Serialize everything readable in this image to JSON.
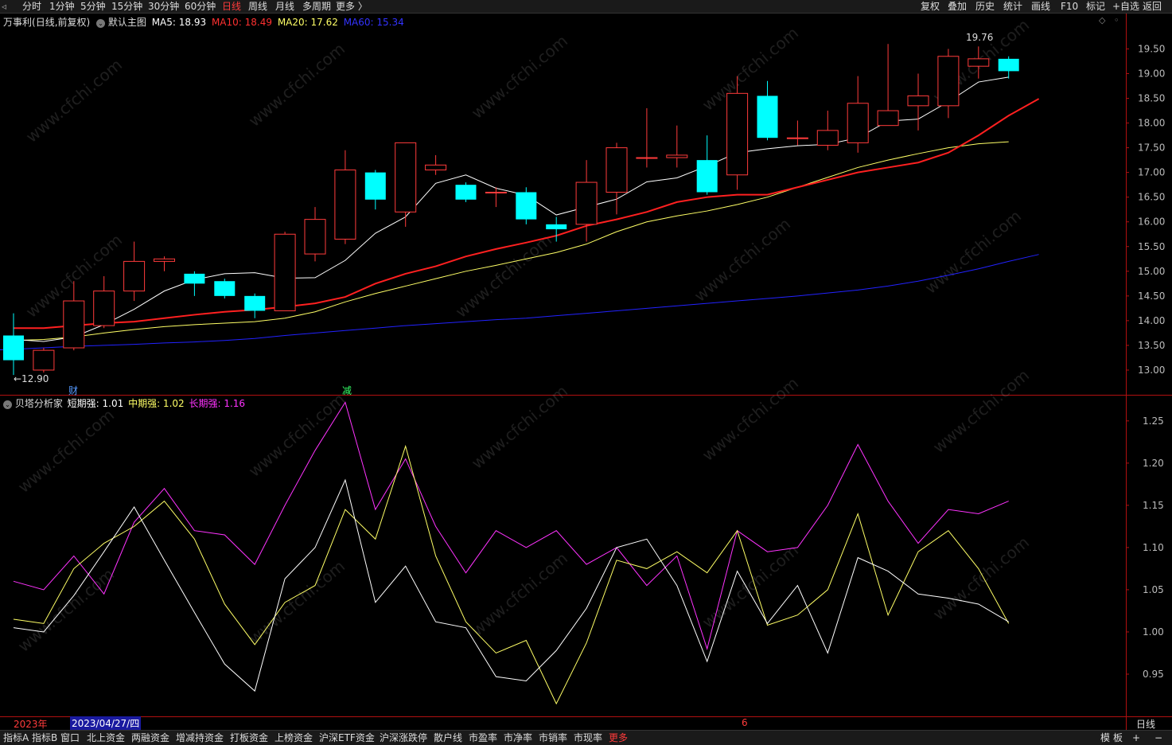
{
  "topbar": {
    "periods": [
      "分时",
      "1分钟",
      "5分钟",
      "15分钟",
      "30分钟",
      "60分钟",
      "日线",
      "周线",
      "月线",
      "多周期",
      "更多 〉"
    ],
    "active": "日线",
    "right_tools": [
      "复权",
      "叠加",
      "历史",
      "统计",
      "画线",
      "F10",
      "标记",
      "+自选",
      "返回"
    ]
  },
  "main_info": {
    "stock": "万事利",
    "period_label": "(日线,前复权)",
    "chart_name": "默认主图",
    "ma5_label": "MA5: 18.93",
    "ma10_label": "MA10: 18.49",
    "ma20_label": "MA20: 17.62",
    "ma60_label": "MA60: 15.34"
  },
  "annotations": {
    "high_label": "19.76",
    "low_label": "←12.90",
    "event_cai": "财",
    "event_jian": "减"
  },
  "indicator_info": {
    "name": "贝塔分析家",
    "short_label": "短期强: 1.01",
    "mid_label": "中期强: 1.02",
    "long_label": "长期强: 1.16"
  },
  "date_axis": {
    "year_label": "2023年",
    "cursor_date": "2023/04/27/四",
    "month_marker": "6",
    "period_right": "日线"
  },
  "bottombar": {
    "tabs": [
      "指标A",
      "指标B",
      "窗口",
      "北上资金",
      "两融资金",
      "增减持资金",
      "打板资金",
      "上榜资金",
      "沪深ETF资金",
      "沪深涨跌停",
      "散户线",
      "市盈率",
      "市净率",
      "市销率",
      "市现率",
      "更多"
    ],
    "right": [
      "模",
      "板",
      "+",
      "−"
    ]
  },
  "colors": {
    "up": "#ff3b3b",
    "down": "#00ffff",
    "ma5": "#ffffff",
    "ma10": "#ff2020",
    "ma20": "#ffff66",
    "ma60": "#2222ff",
    "short": "#ffffff",
    "mid": "#ffff66",
    "long": "#ff33ff"
  },
  "chart_data": [
    {
      "type": "candlestick",
      "title": "万事利 (日线,前复权)",
      "ylim": [
        12.5,
        20.2
      ],
      "yticks": [
        13.0,
        13.5,
        14.0,
        14.5,
        15.0,
        15.5,
        16.0,
        16.5,
        17.0,
        17.5,
        18.0,
        18.5,
        19.0,
        19.5
      ],
      "candles": [
        {
          "o": 13.7,
          "c": 13.2,
          "h": 14.15,
          "l": 12.9
        },
        {
          "o": 13.0,
          "c": 13.4,
          "h": 13.45,
          "l": 12.95
        },
        {
          "o": 13.45,
          "c": 14.4,
          "h": 14.8,
          "l": 13.4
        },
        {
          "o": 13.9,
          "c": 14.6,
          "h": 14.9,
          "l": 13.85
        },
        {
          "o": 14.6,
          "c": 15.2,
          "h": 15.6,
          "l": 14.4
        },
        {
          "o": 15.2,
          "c": 15.25,
          "h": 15.3,
          "l": 15.0
        },
        {
          "o": 14.95,
          "c": 14.75,
          "h": 15.0,
          "l": 14.5
        },
        {
          "o": 14.8,
          "c": 14.5,
          "h": 14.85,
          "l": 14.45
        },
        {
          "o": 14.5,
          "c": 14.2,
          "h": 14.55,
          "l": 14.05
        },
        {
          "o": 14.2,
          "c": 15.75,
          "h": 15.8,
          "l": 14.2
        },
        {
          "o": 15.35,
          "c": 16.05,
          "h": 16.3,
          "l": 15.2
        },
        {
          "o": 15.65,
          "c": 17.05,
          "h": 17.45,
          "l": 15.55
        },
        {
          "o": 17.0,
          "c": 16.45,
          "h": 17.05,
          "l": 16.25
        },
        {
          "o": 16.2,
          "c": 17.6,
          "h": 17.6,
          "l": 15.9
        },
        {
          "o": 17.05,
          "c": 17.15,
          "h": 17.35,
          "l": 16.95
        },
        {
          "o": 16.75,
          "c": 16.45,
          "h": 16.8,
          "l": 16.4
        },
        {
          "o": 16.6,
          "c": 16.6,
          "h": 16.7,
          "l": 16.3
        },
        {
          "o": 16.6,
          "c": 16.05,
          "h": 16.7,
          "l": 15.95
        },
        {
          "o": 15.95,
          "c": 15.85,
          "h": 16.1,
          "l": 15.6
        },
        {
          "o": 15.95,
          "c": 16.8,
          "h": 17.25,
          "l": 15.6
        },
        {
          "o": 16.6,
          "c": 17.5,
          "h": 17.6,
          "l": 16.15
        },
        {
          "o": 17.3,
          "c": 17.3,
          "h": 18.3,
          "l": 17.1
        },
        {
          "o": 17.3,
          "c": 17.35,
          "h": 17.95,
          "l": 17.1
        },
        {
          "o": 17.25,
          "c": 16.6,
          "h": 17.75,
          "l": 16.55
        },
        {
          "o": 16.95,
          "c": 18.6,
          "h": 18.95,
          "l": 16.65
        },
        {
          "o": 18.55,
          "c": 17.7,
          "h": 18.85,
          "l": 17.65
        },
        {
          "o": 17.7,
          "c": 17.7,
          "h": 18.05,
          "l": 17.55
        },
        {
          "o": 17.55,
          "c": 17.85,
          "h": 18.25,
          "l": 17.45
        },
        {
          "o": 17.6,
          "c": 18.4,
          "h": 18.95,
          "l": 17.4
        },
        {
          "o": 17.95,
          "c": 18.25,
          "h": 19.6,
          "l": 17.95
        },
        {
          "o": 18.35,
          "c": 18.55,
          "h": 19.0,
          "l": 17.85
        },
        {
          "o": 18.35,
          "c": 19.35,
          "h": 19.5,
          "l": 18.1
        },
        {
          "o": 19.15,
          "c": 19.3,
          "h": 19.55,
          "l": 18.9
        },
        {
          "o": 19.3,
          "c": 19.05,
          "h": 19.35,
          "l": 18.9
        }
      ],
      "ma5": [
        13.62,
        13.58,
        13.67,
        13.92,
        14.23,
        14.6,
        14.83,
        14.95,
        14.97,
        14.86,
        14.87,
        15.22,
        15.77,
        16.1,
        16.78,
        16.95,
        16.68,
        16.54,
        16.14,
        16.3,
        16.46,
        16.81,
        16.89,
        17.13,
        17.4,
        17.48,
        17.54,
        17.57,
        17.7,
        18.04,
        18.08,
        18.43,
        18.83,
        18.93
      ],
      "ma10": [
        13.85,
        13.85,
        13.9,
        13.95,
        13.98,
        14.05,
        14.12,
        14.18,
        14.22,
        14.28,
        14.35,
        14.48,
        14.75,
        14.95,
        15.1,
        15.3,
        15.45,
        15.58,
        15.72,
        15.92,
        16.05,
        16.2,
        16.4,
        16.5,
        16.55,
        16.55,
        16.7,
        16.85,
        17.0,
        17.1,
        17.2,
        17.4,
        17.75,
        18.15,
        18.49
      ],
      "ma20": [
        13.6,
        13.62,
        13.67,
        13.75,
        13.82,
        13.88,
        13.92,
        13.95,
        13.98,
        14.05,
        14.18,
        14.38,
        14.55,
        14.7,
        14.85,
        15.0,
        15.12,
        15.25,
        15.38,
        15.55,
        15.8,
        16.0,
        16.12,
        16.22,
        16.35,
        16.5,
        16.7,
        16.9,
        17.1,
        17.25,
        17.38,
        17.5,
        17.58,
        17.62
      ],
      "ma60": [
        13.4,
        13.42,
        13.45,
        13.48,
        13.5,
        13.52,
        13.55,
        13.57,
        13.6,
        13.64,
        13.7,
        13.75,
        13.8,
        13.85,
        13.9,
        13.94,
        13.98,
        14.02,
        14.05,
        14.1,
        14.15,
        14.2,
        14.25,
        14.3,
        14.35,
        14.4,
        14.45,
        14.5,
        14.56,
        14.62,
        14.7,
        14.8,
        14.92,
        15.05,
        15.2,
        15.34
      ]
    },
    {
      "type": "line",
      "title": "贝塔分析家",
      "ylim": [
        0.9,
        1.28
      ],
      "yticks": [
        0.95,
        1.0,
        1.05,
        1.1,
        1.15,
        1.2,
        1.25
      ],
      "series": [
        {
          "name": "短期强",
          "values": [
            1.005,
            1.0,
            1.043,
            1.095,
            1.148,
            1.085,
            1.023,
            0.962,
            0.93,
            1.063,
            1.1,
            1.18,
            1.035,
            1.078,
            1.012,
            1.005,
            0.947,
            0.942,
            0.978,
            1.028,
            1.1,
            1.11,
            1.055,
            0.965,
            1.072,
            1.01,
            1.055,
            0.975,
            1.088,
            1.072,
            1.045,
            1.04,
            1.033,
            1.012
          ]
        },
        {
          "name": "中期强",
          "values": [
            1.015,
            1.01,
            1.075,
            1.105,
            1.125,
            1.155,
            1.11,
            1.033,
            0.985,
            1.035,
            1.055,
            1.145,
            1.11,
            1.22,
            1.09,
            1.012,
            0.975,
            0.99,
            0.915,
            0.987,
            1.085,
            1.075,
            1.095,
            1.07,
            1.12,
            1.008,
            1.02,
            1.05,
            1.14,
            1.02,
            1.095,
            1.12,
            1.075,
            1.01
          ]
        },
        {
          "name": "长期强",
          "values": [
            1.06,
            1.05,
            1.09,
            1.045,
            1.13,
            1.17,
            1.12,
            1.115,
            1.08,
            1.15,
            1.215,
            1.272,
            1.145,
            1.205,
            1.125,
            1.07,
            1.12,
            1.1,
            1.12,
            1.08,
            1.1,
            1.055,
            1.09,
            0.98,
            1.12,
            1.095,
            1.1,
            1.15,
            1.222,
            1.155,
            1.105,
            1.145,
            1.14,
            1.155
          ]
        }
      ]
    }
  ]
}
